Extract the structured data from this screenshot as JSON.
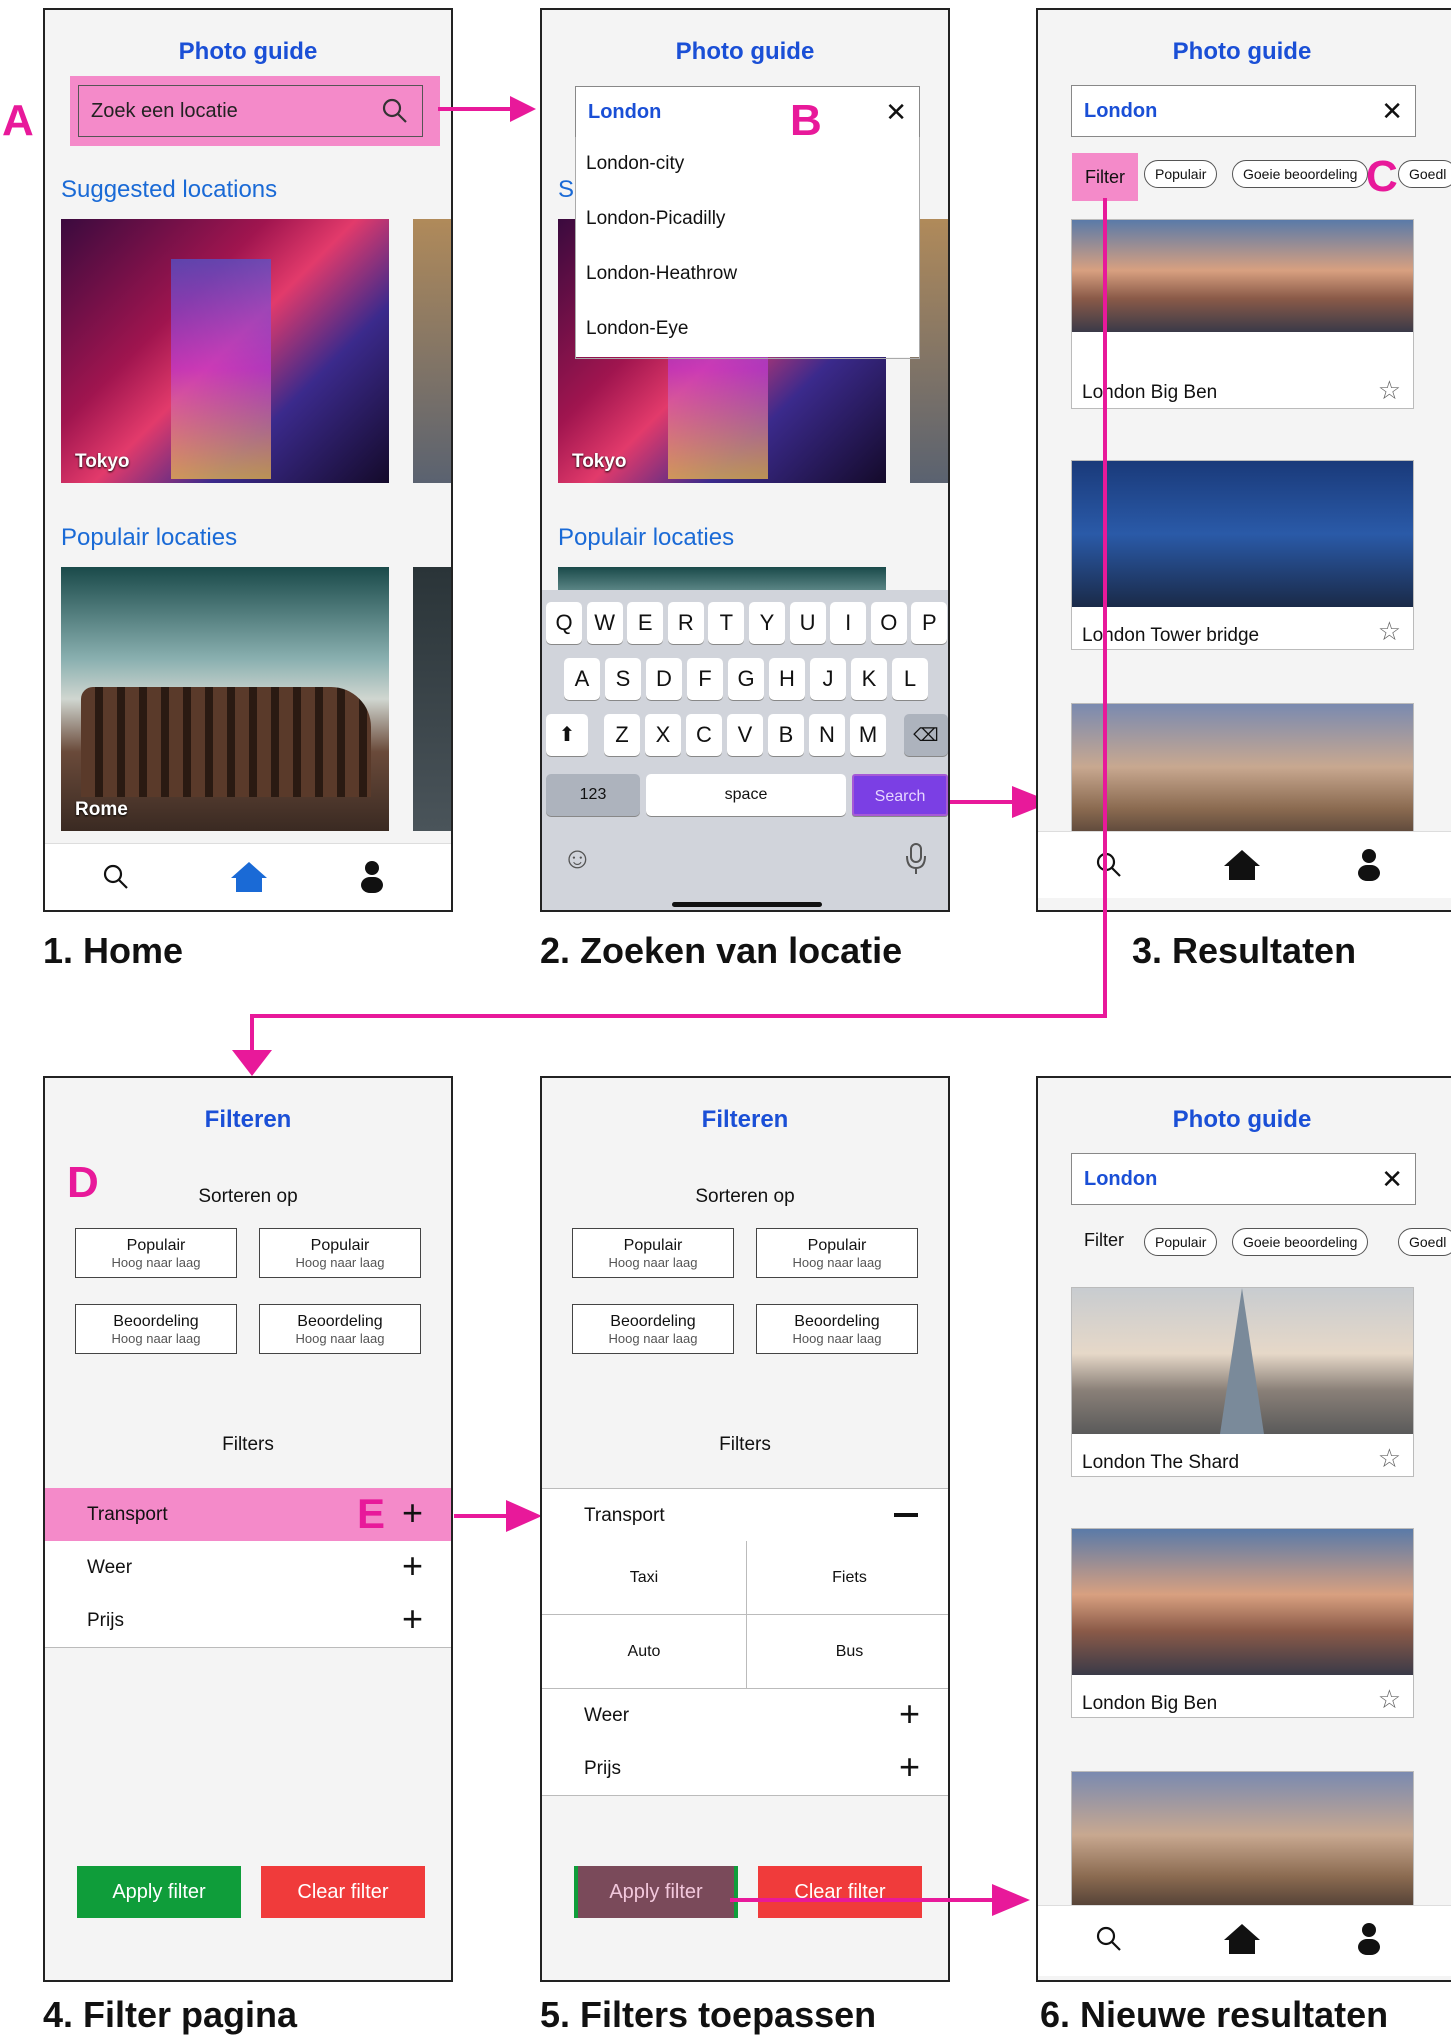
{
  "common": {
    "app_title": "Photo guide",
    "filter_title": "Filteren",
    "search_value": "London"
  },
  "screen1": {
    "search_placeholder": "Zoek een locatie",
    "suggested": "Suggested locations",
    "popular": "Populair locaties",
    "photo1": "Tokyo",
    "photo2": "Rome",
    "caption": "1. Home",
    "marker": "A"
  },
  "screen2": {
    "suggestions": [
      "London-city",
      "London-Picadilly",
      "London-Heathrow",
      "London-Eye"
    ],
    "section_letter": "S",
    "popular": "Populair locaties",
    "photo1": "Tokyo",
    "keys_row1": [
      "Q",
      "W",
      "E",
      "R",
      "T",
      "Y",
      "U",
      "I",
      "O",
      "P"
    ],
    "keys_row2": [
      "A",
      "S",
      "D",
      "F",
      "G",
      "H",
      "J",
      "K",
      "L"
    ],
    "keys_row3": [
      "Z",
      "X",
      "C",
      "V",
      "B",
      "N",
      "M"
    ],
    "key_123": "123",
    "key_space": "space",
    "key_search": "Search",
    "caption": "2. Zoeken van locatie",
    "marker": "B"
  },
  "screen3": {
    "filter": "Filter",
    "chips": [
      "Populair",
      "Goeie beoordeling",
      "Goedl"
    ],
    "cards": [
      "London Big Ben",
      "London Tower bridge"
    ],
    "caption": "3. Resultaten",
    "marker": "C"
  },
  "screen4": {
    "sort_heading": "Sorteren op",
    "sort_buttons": [
      {
        "l1": "Populair",
        "l2": "Hoog naar laag"
      },
      {
        "l1": "Populair",
        "l2": "Hoog naar laag"
      },
      {
        "l1": "Beoordeling",
        "l2": "Hoog naar laag"
      },
      {
        "l1": "Beoordeling",
        "l2": "Hoog naar laag"
      }
    ],
    "filters_heading": "Filters",
    "rows": [
      "Transport",
      "Weer",
      "Prijs"
    ],
    "apply": "Apply filter",
    "clear": "Clear filter",
    "caption": "4. Filter pagina",
    "marker_d": "D",
    "marker_e": "E"
  },
  "screen5": {
    "transport_options": [
      "Taxi",
      "Fiets",
      "Auto",
      "Bus"
    ],
    "caption": "5. Filters toepassen"
  },
  "screen6": {
    "cards": [
      "London The Shard",
      "London Big Ben"
    ],
    "caption": "6. Nieuwe resultaten"
  },
  "colors": {
    "accent_blue": "#1a4fd6",
    "highlight_pink": "#f48ac9",
    "arrow_pink": "#e8199a",
    "apply_green": "#0f9d3a",
    "clear_red": "#f03b3b",
    "search_purple": "#7b3fe4"
  }
}
